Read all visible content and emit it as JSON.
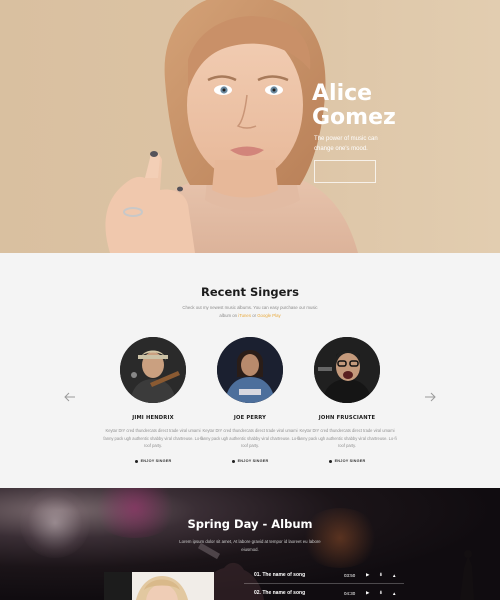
{
  "hero": {
    "name_line1": "Alice",
    "name_line2": "Gomez",
    "tagline": "The power of music can change one's mood.",
    "button_label": ""
  },
  "recent_singers": {
    "title": "Recent Singers",
    "desc_line1": "Check out my newest music albums. You can easy purchase our music",
    "desc_line2_before": "album on",
    "desc_link1": "iTunes",
    "desc_between": "or",
    "desc_link2": "Google Play",
    "prev_icon": "arrow-left-icon",
    "next_icon": "arrow-right-icon",
    "singers": [
      {
        "name": "JIMI HENDRIX",
        "bio": "Keytar DIY cred thundercats direct trade viral umami fanny pack ugh authentic shabby viral chartreuse. Lo-fi roof party.",
        "tag": "ENJOY SINGER"
      },
      {
        "name": "JOE PERRY",
        "bio": "Keytar DIY cred thundercats direct trade viral umami fanny pack ugh authentic shabby viral chartreuse. Lo-fi roof party.",
        "tag": "ENJOY SINGER"
      },
      {
        "name": "JOHN FRUSCIANTE",
        "bio": "Keytar DIY cred thundercats direct trade viral umami fanny pack ugh authentic shabby viral chartreuse. Lo-fi roof party.",
        "tag": "ENJOY SINGER"
      }
    ]
  },
  "album": {
    "title": "Spring Day - Album",
    "desc": "Lorem ipsum dolor sit amet, At labore gravid at tempor id laoreet eu labore eiusmod.",
    "tracks": [
      {
        "title": "01. The name of song",
        "time": "03:50",
        "play_icon": "play-icon",
        "download_icon": "download-icon",
        "share_icon": "share-icon"
      },
      {
        "title": "02. The name of song",
        "time": "04:30",
        "play_icon": "play-icon",
        "download_icon": "download-icon",
        "share_icon": "share-icon"
      }
    ]
  },
  "colors": {
    "accent": "#e8a93c",
    "hero_bg": "#dcc3a4",
    "section_bg": "#f4f4f4",
    "album_bg": "#120e12"
  }
}
